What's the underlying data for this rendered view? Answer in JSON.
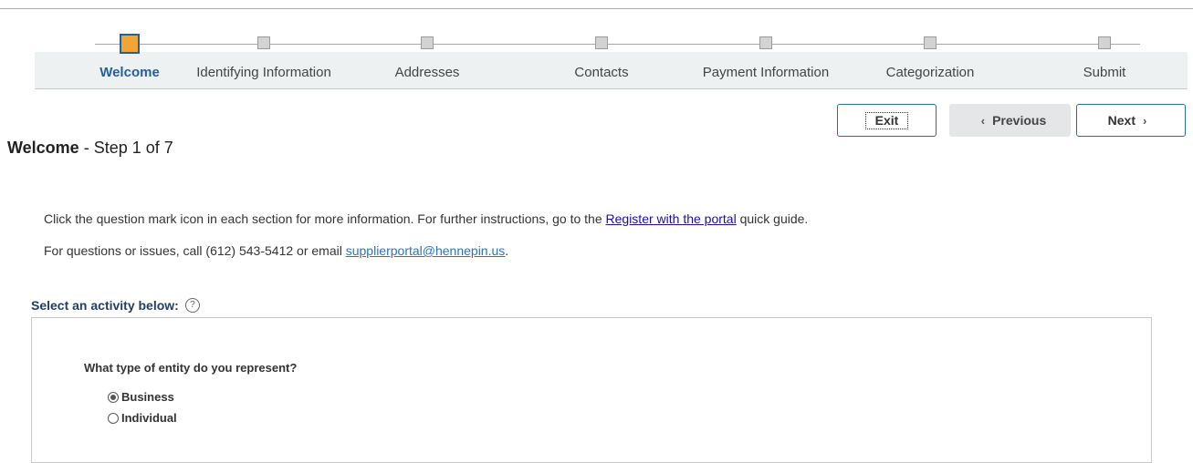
{
  "train": {
    "steps": [
      {
        "label": "Welcome",
        "state": "active"
      },
      {
        "label": "Identifying Information",
        "state": "pending"
      },
      {
        "label": "Addresses",
        "state": "pending"
      },
      {
        "label": "Contacts",
        "state": "pending"
      },
      {
        "label": "Payment Information",
        "state": "pending"
      },
      {
        "label": "Categorization",
        "state": "pending"
      },
      {
        "label": "Submit",
        "state": "pending"
      }
    ]
  },
  "toolbar": {
    "exit_label": "Exit",
    "previous_label": "Previous",
    "next_label": "Next",
    "previous_icon": "chevron-left-icon",
    "next_icon": "chevron-right-icon"
  },
  "page": {
    "title": "Welcome",
    "step_text": " - Step 1 of 7"
  },
  "instructions": {
    "line1_before": "Click the question mark icon in each section for more information. For further instructions, go to the ",
    "line1_link": "Register with the portal",
    "line1_after": " quick guide.",
    "line2_before": "For questions or issues, call (612) 543-5412 or email ",
    "line2_link": "supplierportal@hennepin.us",
    "line2_after": "."
  },
  "activity": {
    "heading": "Select an activity below:",
    "help_icon": "question-circle-icon",
    "question": "What type of entity do you represent?",
    "options": [
      {
        "label": "Business",
        "selected": true
      },
      {
        "label": "Individual",
        "selected": false
      }
    ]
  },
  "colors": {
    "active_step_fill": "#f3a533",
    "active_step_border": "#26609a",
    "link": "#1a0dab",
    "email_link": "#2e73b8"
  }
}
